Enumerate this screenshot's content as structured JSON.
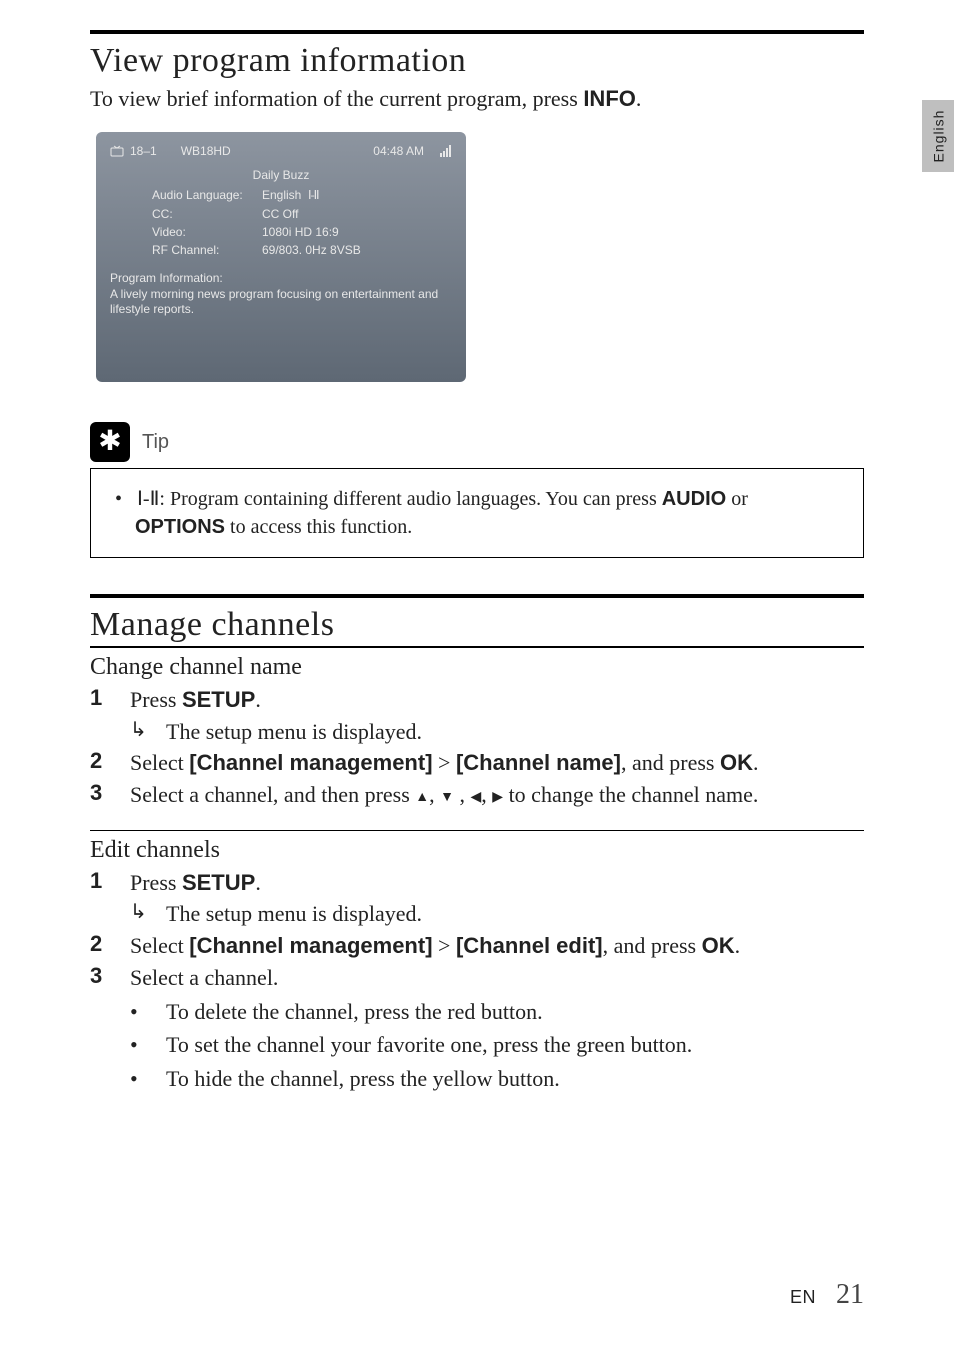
{
  "languageTab": "English",
  "section1": {
    "title": "View program information",
    "intro_a": "To view brief information of the current program, press ",
    "intro_b": "INFO",
    "intro_c": "."
  },
  "infoPanel": {
    "channelNumber": "18–1",
    "channelName": "WB18HD",
    "time": "04:48 AM",
    "programTitle": "Daily Buzz",
    "labels": {
      "audioLanguage": "Audio Language:",
      "cc": "CC:",
      "video": "Video:",
      "rf": "RF Channel:"
    },
    "values": {
      "audioLanguage": "English",
      "audioMode": "Ⅰ-Ⅱ",
      "cc": "CC Off",
      "video": "1080i HD 16:9",
      "rf": "69/803. 0Hz 8VSB"
    },
    "piHeader": "Program Information:",
    "piBody": "A lively  morning news program focusing on entertainment and lifestyle reports."
  },
  "tip": {
    "label": "Tip",
    "icon_prefix": "Ⅰ-Ⅱ",
    "t1": ": Program containing different audio languages. You can press ",
    "t2": "AUDIO",
    "t3": " or ",
    "t4": "OPTIONS",
    "t5": " to access this function."
  },
  "section2": {
    "title": "Manage channels",
    "changeName": {
      "heading": "Change channel name",
      "step1_a": "Press ",
      "step1_b": "SETUP",
      "step1_c": ".",
      "result1": "The setup menu is displayed.",
      "step2_a": "Select ",
      "step2_b": "[Channel management]",
      "step2_c": " > ",
      "step2_d": "[Channel name]",
      "step2_e": ", and press ",
      "step2_f": "OK",
      "step2_g": ".",
      "step3_a": "Select a channel, and then press ",
      "step3_b": " to change the channel name."
    },
    "editChannels": {
      "heading": "Edit channels",
      "step1_a": "Press ",
      "step1_b": "SETUP",
      "step1_c": ".",
      "result1": "The setup menu is displayed.",
      "step2_a": "Select ",
      "step2_b": "[Channel management]",
      "step2_c": " > ",
      "step2_d": "[Channel edit]",
      "step2_e": ", and press ",
      "step2_f": "OK",
      "step2_g": ".",
      "step3": "Select a channel.",
      "bullet1": "To delete the channel, press the red button.",
      "bullet2": "To set the channel your favorite one, press the green button.",
      "bullet3": "To hide the channel, press the yellow button."
    }
  },
  "footer": {
    "lang": "EN",
    "page": "21"
  },
  "nums": {
    "n1": "1",
    "n2": "2",
    "n3": "3"
  },
  "bullet": "•",
  "arrow": "↳"
}
